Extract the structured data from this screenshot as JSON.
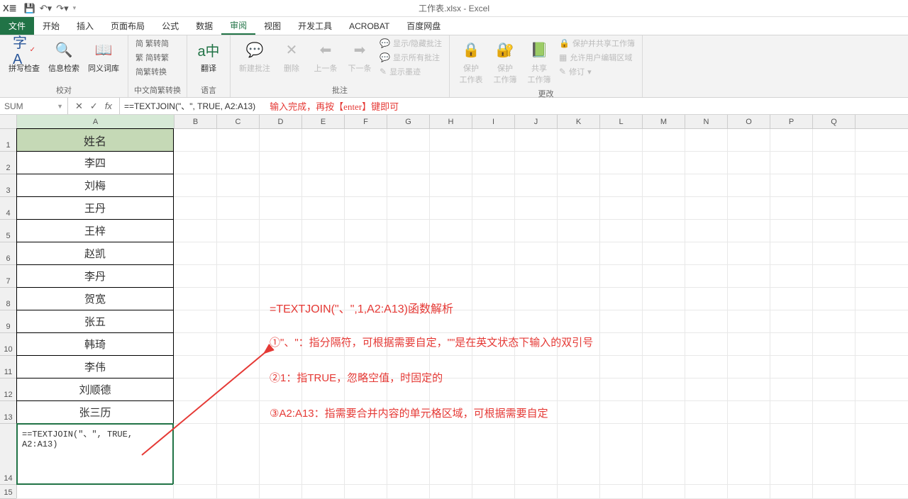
{
  "title": "工作表.xlsx - Excel",
  "tabs": {
    "file": "文件",
    "home": "开始",
    "insert": "插入",
    "layout": "页面布局",
    "formulas": "公式",
    "data": "数据",
    "review": "审阅",
    "view": "视图",
    "dev": "开发工具",
    "acrobat": "ACROBAT",
    "baidu": "百度网盘"
  },
  "ribbon": {
    "proofing": {
      "spell": "拼写检查",
      "research": "信息检索",
      "thesaurus": "同义词库",
      "label": "校对"
    },
    "cn": {
      "s2t": "简 繁转简",
      "t2s": "繁 简转繁",
      "conv": "简繁转换",
      "btn": "中文简繁转换",
      "label": "中文简繁转换"
    },
    "lang": {
      "translate": "翻译",
      "label": "语言"
    },
    "comments": {
      "new": "新建批注",
      "del": "删除",
      "prev": "上一条",
      "next": "下一条",
      "show": "显示/隐藏批注",
      "showall": "显示所有批注",
      "ink": "显示墨迹",
      "label": "批注"
    },
    "protect": {
      "sheet": "保护\n工作表",
      "wb": "保护\n工作簿",
      "share": "共享\n工作簿",
      "shareprotect": "保护并共享工作簿",
      "allowedit": "允许用户编辑区域",
      "track": "修订",
      "label": "更改"
    }
  },
  "namebox": "SUM",
  "formula": "==TEXTJOIN(\"、\", TRUE, A2:A13)",
  "formula_hint": "输入完成，再按【enter】键即可",
  "columns": [
    "A",
    "B",
    "C",
    "D",
    "E",
    "F",
    "G",
    "H",
    "I",
    "J",
    "K",
    "L",
    "M",
    "N",
    "O",
    "P",
    "Q"
  ],
  "data_rows": [
    {
      "n": 1,
      "v": "姓名",
      "header": true
    },
    {
      "n": 2,
      "v": "李四"
    },
    {
      "n": 3,
      "v": "刘梅"
    },
    {
      "n": 4,
      "v": "王丹"
    },
    {
      "n": 5,
      "v": "王梓"
    },
    {
      "n": 6,
      "v": "赵凯"
    },
    {
      "n": 7,
      "v": "李丹"
    },
    {
      "n": 8,
      "v": "贺宽"
    },
    {
      "n": 9,
      "v": "张五"
    },
    {
      "n": 10,
      "v": "韩琦"
    },
    {
      "n": 11,
      "v": "李伟"
    },
    {
      "n": 12,
      "v": "刘顺德"
    },
    {
      "n": 13,
      "v": "张三历"
    }
  ],
  "editing_cell": "==TEXTJOIN(\"、\", TRUE, A2:A13)",
  "annotations": {
    "a1": "=TEXTJOIN(\"、\",1,A2:A13)函数解析",
    "a2": "①\"、\"：指分隔符，可根据需要自定，\"\"是在英文状态下输入的双引号",
    "a3": "②1：指TRUE，忽略空值，时固定的",
    "a4": "③A2:A13：指需要合并内容的单元格区域，可根据需要自定"
  }
}
